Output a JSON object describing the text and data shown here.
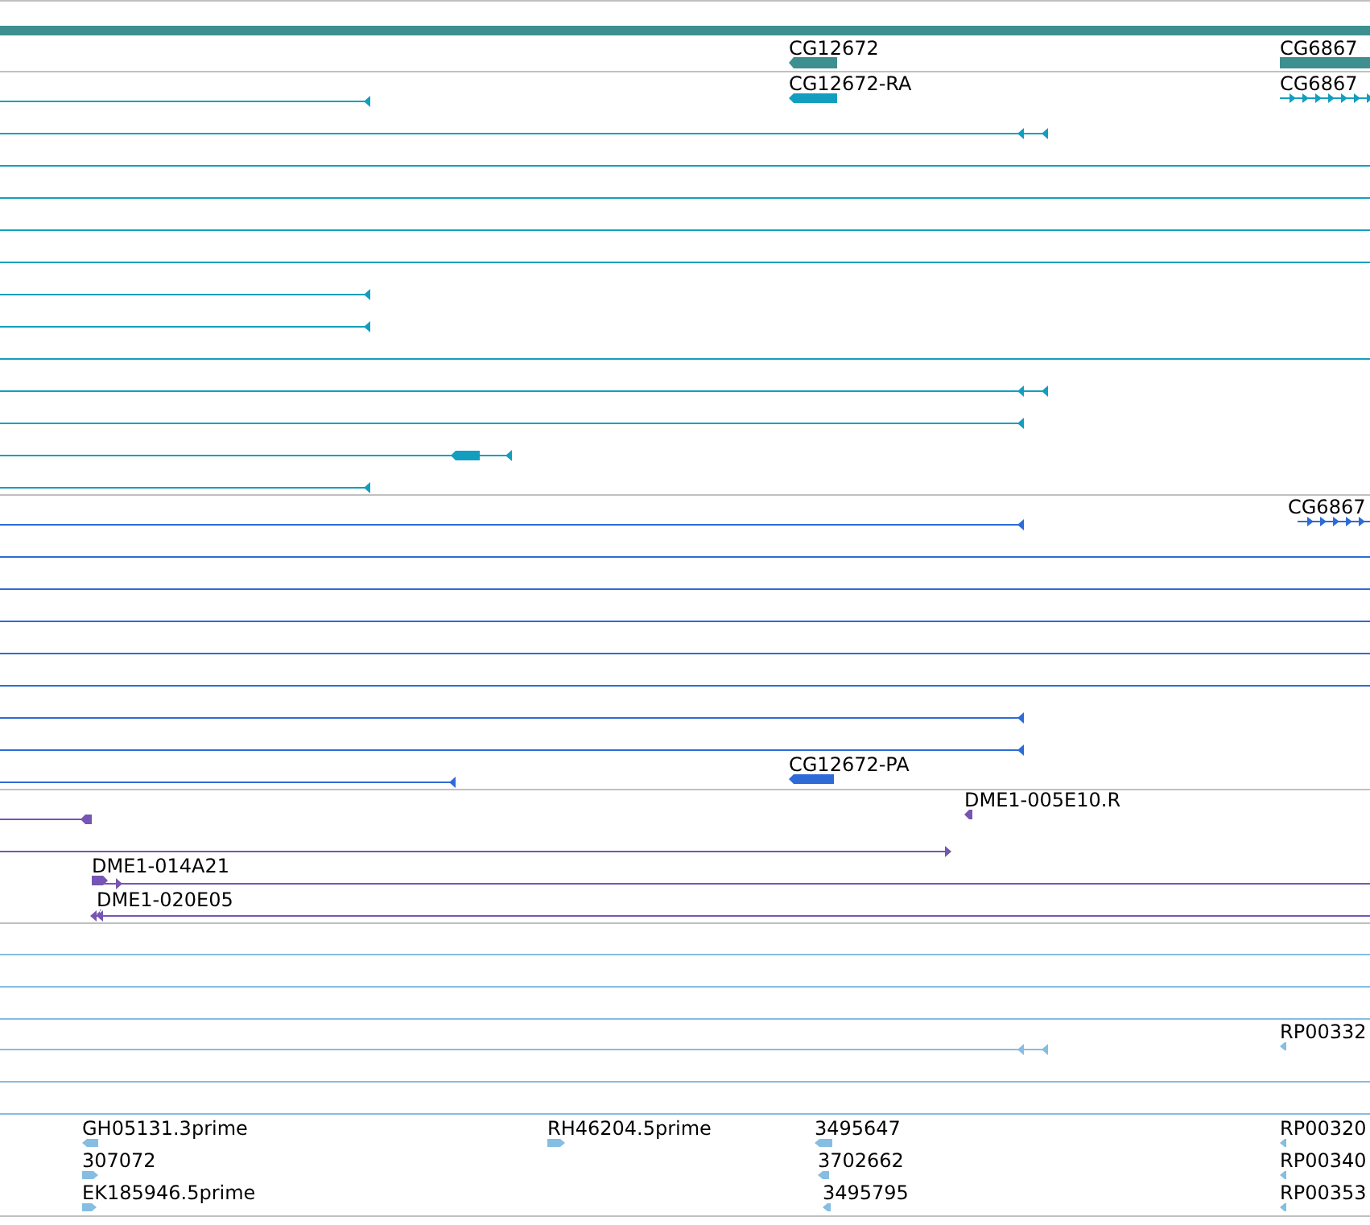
{
  "tracks": [
    {
      "kind": "gene",
      "color": "#3d8f90",
      "labels": [
        "CG12672",
        "CG6867"
      ]
    },
    {
      "kind": "transcript",
      "color": "#129fbf",
      "labels": [
        "CG12672-RA",
        "CG6867"
      ]
    },
    {
      "kind": "transcript",
      "color": "#2e6bd6",
      "labels": [
        "CG6867",
        "CG12672-PA"
      ]
    },
    {
      "kind": "clone",
      "color": "#7655b3",
      "labels": [
        "DME1-005E10.R",
        "DME1-014A21",
        "DME1-020E05"
      ]
    },
    {
      "kind": "est",
      "color": "#85bde3",
      "labels": [
        "RP00332",
        "GH05131.3prime",
        "RH46204.5prime",
        "3495647",
        "RP00320",
        "307072",
        "3702662",
        "RP00340",
        "EK185946.5prime",
        "3495795",
        "RP00353"
      ]
    }
  ]
}
